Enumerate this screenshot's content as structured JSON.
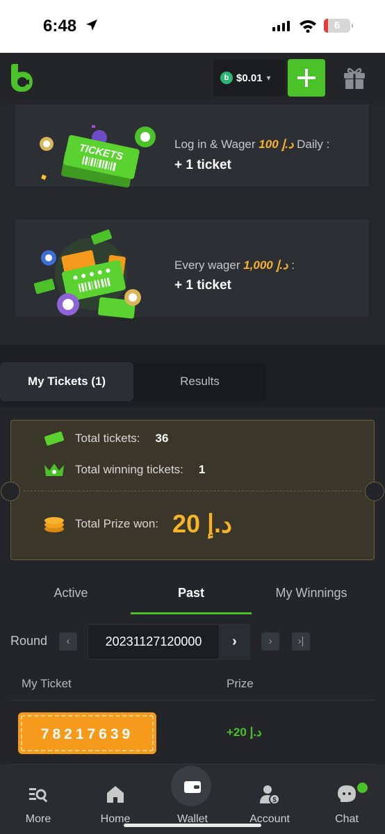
{
  "status_bar": {
    "time": "6:48",
    "battery": "6"
  },
  "header": {
    "balance": "$0.01",
    "balance_coin_letter": "b",
    "add_label": "+",
    "accent": "#4bc12a"
  },
  "promos": [
    {
      "text_before": "Log in & Wager ",
      "amount": "100 د.إ",
      "text_after": " Daily :",
      "reward": "+ 1 ticket",
      "image_text": "TICKETS"
    },
    {
      "text_before": "Every wager ",
      "amount": "1,000 د.إ",
      "text_after": " :",
      "reward": "+ 1 ticket"
    }
  ],
  "ticket_tabs": {
    "my_tickets": "My Tickets (1)",
    "results": "Results"
  },
  "summary": {
    "total_tickets_label": "Total tickets:",
    "total_tickets": "36",
    "winning_label": "Total winning tickets:",
    "winning": "1",
    "prize_label": "Total Prize won:",
    "prize": "20 د.إ"
  },
  "sub_tabs": [
    "Active",
    "Past",
    "My Winnings"
  ],
  "round": {
    "label": "Round",
    "value": "20231127120000"
  },
  "table": {
    "col_ticket": "My Ticket",
    "col_prize": "Prize",
    "rows": [
      {
        "ticket": "78217639",
        "prize": "+20 د.إ"
      }
    ]
  },
  "nav": [
    "More",
    "Home",
    "Wallet",
    "Account",
    "Chat"
  ]
}
